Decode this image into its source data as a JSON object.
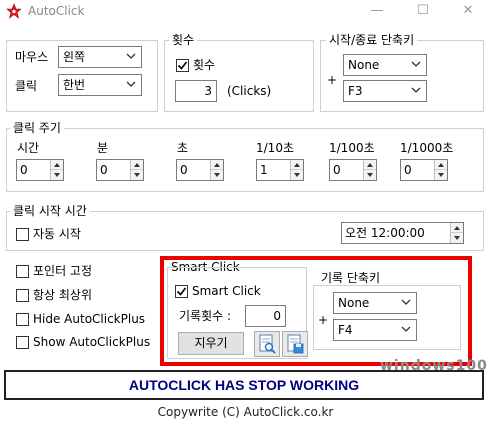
{
  "window": {
    "title": "AutoClick",
    "controls": {
      "minimize": "—",
      "maximize": "☐",
      "close": "✕"
    }
  },
  "mouse_group": {
    "mouse_label": "마우스",
    "mouse_value": "왼쪽",
    "click_label": "클릭",
    "click_value": "한번"
  },
  "count_group": {
    "title": "횟수",
    "checkbox_label": "횟수",
    "checked": true,
    "count_value": "3",
    "unit_label": "(Clicks)"
  },
  "hotkey_group": {
    "title": "시작/종료 단축키",
    "plus": "+",
    "modifier_value": "None",
    "key_value": "F3"
  },
  "interval_group": {
    "title": "클릭 주기",
    "fields": [
      {
        "label": "시간",
        "value": "0"
      },
      {
        "label": "분",
        "value": "0"
      },
      {
        "label": "초",
        "value": "0"
      },
      {
        "label": "1/10초",
        "value": "1"
      },
      {
        "label": "1/100초",
        "value": "0"
      },
      {
        "label": "1/1000초",
        "value": "0"
      }
    ]
  },
  "start_time_group": {
    "title": "클릭 시작 시간",
    "auto_start_label": "자동 시작",
    "auto_start_checked": false,
    "time_value": "오전 12:00:00"
  },
  "options": {
    "items": [
      {
        "label": "포인터 고정",
        "checked": false
      },
      {
        "label": "항상 최상위",
        "checked": false
      },
      {
        "label": "Hide AutoClickPlus",
        "checked": false
      },
      {
        "label": "Show AutoClickPlus",
        "checked": false
      }
    ]
  },
  "smart_click": {
    "title": "Smart Click",
    "checkbox_label": "Smart Click",
    "checked": true,
    "record_count_label": "기록횟수 :",
    "record_count_value": "0",
    "clear_button": "지우기",
    "record_hotkey_title": "기록 단축키",
    "plus": "+",
    "modifier_value": "None",
    "key_value": "F4"
  },
  "status_text": "AUTOCLICK HAS STOP WORKING",
  "footer_text": "Copywrite (C) AutoClick.co.kr",
  "watermark_text": "windows100",
  "colors": {
    "highlight_border": "#ee0000",
    "status_text": "#000080",
    "app_icon": "#e02020"
  }
}
